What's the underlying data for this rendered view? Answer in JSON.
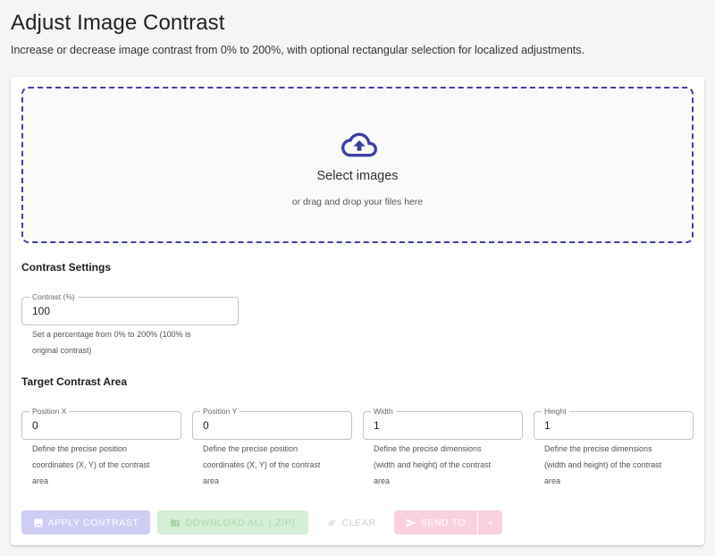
{
  "header": {
    "title": "Adjust Image Contrast",
    "subtitle": "Increase or decrease image contrast from 0% to 200%, with optional rectangular selection for localized adjustments."
  },
  "dropzone": {
    "title": "Select images",
    "subtitle": "or drag and drop your files here",
    "icon": "cloud-upload-icon",
    "accent_color": "#3f3fa8"
  },
  "contrast_settings": {
    "section_title": "Contrast Settings",
    "contrast_field": {
      "label": "Contrast (%)",
      "value": "100",
      "helper_line1": "Set a percentage from 0% to 200% (100% is",
      "helper_line2": "original contrast)"
    }
  },
  "target_area": {
    "section_title": "Target Contrast Area",
    "fields": [
      {
        "label": "Position X",
        "value": "0",
        "helper_line1": "Define the precise position",
        "helper_line2": "coordinates (X, Y) of the contrast",
        "helper_line3": "area"
      },
      {
        "label": "Position Y",
        "value": "0",
        "helper_line1": "Define the precise position",
        "helper_line2": "coordinates (X, Y) of the contrast",
        "helper_line3": "area"
      },
      {
        "label": "Width",
        "value": "1",
        "helper_line1": "Define the precise dimensions",
        "helper_line2": "(width and height) of the contrast",
        "helper_line3": "area"
      },
      {
        "label": "Height",
        "value": "1",
        "helper_line1": "Define the precise dimensions",
        "helper_line2": "(width and height) of the contrast",
        "helper_line3": "area"
      }
    ]
  },
  "actions": {
    "apply_label": "Apply Contrast",
    "download_label": "Download All (.zip)",
    "clear_label": "Clear",
    "send_label": "Send To"
  }
}
